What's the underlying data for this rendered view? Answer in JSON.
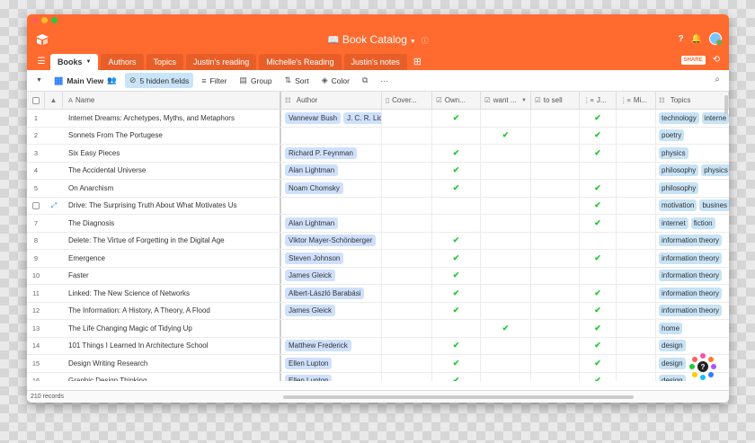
{
  "window": {
    "title": "Book Catalog",
    "colors": {
      "accent": "#ff6a2f",
      "close": "#ff5f57",
      "minimize": "#ffbd2e",
      "zoom": "#28c940",
      "check": "#20c933"
    }
  },
  "tabs": [
    "Books",
    "Authors",
    "Topics",
    "Justin's reading",
    "Michelle's Reading",
    "Justin's notes"
  ],
  "share_label": "SHARE",
  "toolbar": {
    "view_name": "Main View",
    "hidden_fields": "5 hidden fields",
    "filter": "Filter",
    "group": "Group",
    "sort": "Sort",
    "color": "Color",
    "more": "···"
  },
  "columns": {
    "name": "Name",
    "author": "Author",
    "cover": "Cover...",
    "own": "Own...",
    "want": "want ...",
    "sell": "to sell",
    "j": "J...",
    "mi": "Mi...",
    "topics": "Topics"
  },
  "rows": [
    {
      "num": "1",
      "name": "Internet Dreams: Archetypes, Myths, and Metaphors",
      "authors": [
        "Vannevar Bush",
        "J. C. R. Lic"
      ],
      "own": true,
      "want": false,
      "sell": false,
      "j": true,
      "topics": [
        "technology",
        "interne"
      ]
    },
    {
      "num": "2",
      "name": "Sonnets From The Portugese",
      "authors": [],
      "own": false,
      "want": true,
      "sell": false,
      "j": true,
      "topics": [
        "poetry"
      ]
    },
    {
      "num": "3",
      "name": "Six Easy Pieces",
      "authors": [
        "Richard P. Feynman"
      ],
      "own": true,
      "want": false,
      "sell": false,
      "j": true,
      "topics": [
        "physics"
      ]
    },
    {
      "num": "4",
      "name": "The Accidental Universe",
      "authors": [
        "Alan Lightman"
      ],
      "own": true,
      "want": false,
      "sell": false,
      "j": false,
      "topics": [
        "philosophy",
        "physics"
      ]
    },
    {
      "num": "5",
      "name": "On Anarchism",
      "authors": [
        "Noam Chomsky"
      ],
      "own": true,
      "want": false,
      "sell": false,
      "j": true,
      "topics": [
        "philosophy"
      ]
    },
    {
      "num": "",
      "name": "Drive: The Surprising Truth About What Motivates Us",
      "authors": [],
      "own": false,
      "want": false,
      "sell": false,
      "j": true,
      "topics": [
        "motivation",
        "busines"
      ],
      "hovered": true
    },
    {
      "num": "7",
      "name": "The Diagnosis",
      "authors": [
        "Alan Lightman"
      ],
      "own": false,
      "want": false,
      "sell": false,
      "j": true,
      "topics": [
        "internet",
        "fiction"
      ]
    },
    {
      "num": "8",
      "name": "Delete: The Virtue of Forgetting in the Digital Age",
      "authors": [
        "Viktor Mayer-Schönberger"
      ],
      "own": true,
      "want": false,
      "sell": false,
      "j": false,
      "topics": [
        "information theory"
      ]
    },
    {
      "num": "9",
      "name": "Emergence",
      "authors": [
        "Steven Johnson"
      ],
      "own": true,
      "want": false,
      "sell": false,
      "j": true,
      "topics": [
        "information theory"
      ]
    },
    {
      "num": "10",
      "name": "Faster",
      "authors": [
        "James Gleick"
      ],
      "own": true,
      "want": false,
      "sell": false,
      "j": false,
      "topics": [
        "information theory"
      ]
    },
    {
      "num": "11",
      "name": "Linked: The New Science of Networks",
      "authors": [
        "Albert-László Barabási"
      ],
      "own": true,
      "want": false,
      "sell": false,
      "j": true,
      "topics": [
        "information theory"
      ]
    },
    {
      "num": "12",
      "name": "The Information: A History, A Theory, A Flood",
      "authors": [
        "James Gleick"
      ],
      "own": true,
      "want": false,
      "sell": false,
      "j": true,
      "topics": [
        "information theory"
      ]
    },
    {
      "num": "13",
      "name": "The Life Changing Magic of Tidying Up",
      "authors": [],
      "own": false,
      "want": true,
      "sell": false,
      "j": true,
      "topics": [
        "home"
      ]
    },
    {
      "num": "14",
      "name": "101 Things I Learned In Architecture School",
      "authors": [
        "Matthew Frederick"
      ],
      "own": true,
      "want": false,
      "sell": false,
      "j": true,
      "topics": [
        "design"
      ]
    },
    {
      "num": "15",
      "name": "Design Writing Research",
      "authors": [
        "Ellen Lupton"
      ],
      "own": true,
      "want": false,
      "sell": false,
      "j": true,
      "topics": [
        "design"
      ]
    },
    {
      "num": "16",
      "name": "Graphic Design Thinking",
      "authors": [
        "Ellen Lupton"
      ],
      "own": true,
      "want": false,
      "sell": false,
      "j": true,
      "topics": [
        "design"
      ]
    }
  ],
  "footer": {
    "records": "210 records"
  },
  "help_label": "?"
}
